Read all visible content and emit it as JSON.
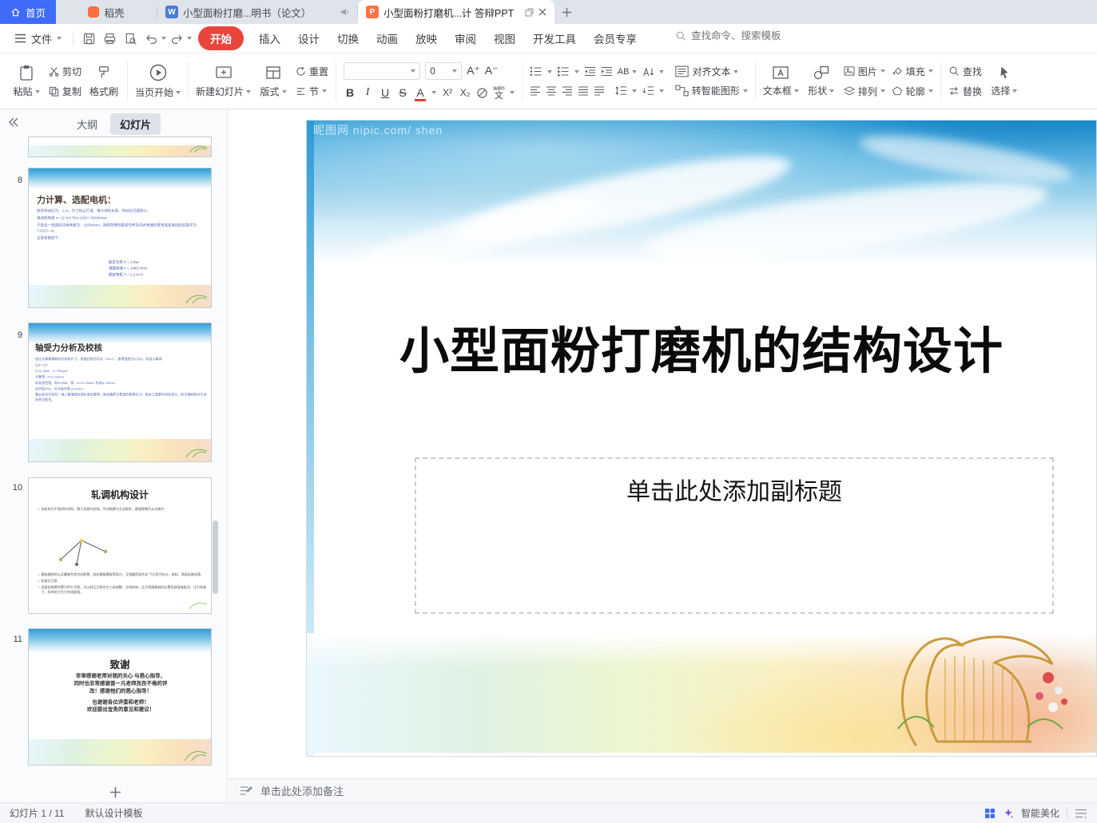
{
  "colors": {
    "home_tab_blue": "#3f6bfa",
    "start_pill_red": "#e8443a",
    "ppt_icon_orange": "#ff7243",
    "writer_icon_blue": "#4b7bd6",
    "sky_blue": "#2d9bd6",
    "beautify_blue": "#3f6bfa"
  },
  "icons": {
    "writer_letter": "W",
    "ppt_letter": "P"
  },
  "tabbar": {
    "home": "首页",
    "docer": "稻壳",
    "doc_tab": "小型面粉打磨...明书（论文）",
    "ppt_tab": "小型面粉打磨机...计 答辩PPT"
  },
  "menubar": {
    "file": "文件",
    "items": [
      "开始",
      "插入",
      "设计",
      "切换",
      "动画",
      "放映",
      "审阅",
      "视图",
      "开发工具",
      "会员专享"
    ],
    "search_placeholder": "查找命令、搜索模板"
  },
  "ribbon": {
    "paste": "粘贴",
    "cut": "剪切",
    "copy": "复制",
    "format_painter": "格式刷",
    "start_page": "当页开始",
    "new_slide": "新建幻灯片",
    "layout": "版式",
    "reset": "重置",
    "section": "节",
    "font_size_value": "0",
    "grow": "A⁺",
    "shrink": "A⁻",
    "bold": "B",
    "italic": "I",
    "underline": "U",
    "strike": "S",
    "font_color": "A",
    "sup": "X²",
    "sub": "X₂",
    "pinyin_top": "wén",
    "pinyin_bottom": "文",
    "ab": "AB",
    "align_text": "对齐文本",
    "to_smartart": "转智能图形",
    "textbox": "文本框",
    "shape": "形状",
    "picture": "图片",
    "fill": "填充",
    "arrange": "排列",
    "outline": "轮廓",
    "find": "查找",
    "replace": "替换",
    "select": "选择"
  },
  "sidebar": {
    "tab_outline": "大纲",
    "tab_slides": "幻灯片",
    "slides": [
      {
        "num": "8",
        "title": "力计算、选配电机：",
        "paras": [
          "皮带传动比为：2~4，为了防止打滑，增大带轮包角，传动比尽量取小。",
          "电动机转速 n= (2~4)×750=1500～3000r/min",
          "于是这一范围的同步转速为：1500r/min，按照所需的额定功率及同步转速的要求选定电动机的型号为Y132S—4。",
          "主要参数如下："
        ],
        "params": [
          "额定功率 P = 4 kW",
          "满载转速 n = 1440 r/min",
          "额定转矩 T = 2.2 N·m"
        ]
      },
      {
        "num": "9",
        "title": "轴受力分析及校核",
        "lines": [
          "经过计算最薄弱处的结构尺寸，根据扭转剪切式（15-2），查得强度为公式A、标准计算表：",
          "以A=110.",
          "P=5.23kw　n=750rpm",
          "计算得: d=21.02mm",
          "标准直径值、取d≈30B、得，d=21.49mm; 标准d=32mm.",
          "初步取25A，对为轴可得 d=42mm",
          "最后综合分析时，轴上最薄弱处按标准的套筒，联系圆筒主要受的套筒压力；联系三类要传给标筑元；取正确转矩并与齿轮密切配合。"
        ]
      },
      {
        "num": "10",
        "title": "轧调机构设计",
        "bullets": [
          "本机构为平面四杆机构，属于双摇杆机构。中间摇臂为主动摇杆，磨辊摇臂为从动摇杆",
          "磨辊磨损时以及翻辊共距空间配置、轻松磨辊磨辊等高为、互相磨距离合化 气压密力松分、紧料、两面标移松落",
          "松紧压力泵",
          "此紧松装置布置可传力平衡，可以料压力泵的大小来调整、点钱的床、压力泵随着轴向位置的改变笔板花、压力泵临介、机构的工作力作成疲强。"
        ]
      },
      {
        "num": "11",
        "title": "致谢",
        "lines": [
          "非常感谢老师对我的关心 与悉心指导，",
          "同时也非常感谢曾一凡老师孜孜不倦的评",
          "改！感谢他们的悉心指导！",
          "也谢谢各位评委和老师！",
          "欢迎提出宝贵的意见和建议！"
        ]
      }
    ]
  },
  "canvas": {
    "watermark": "昵图网 nipic.com/ shen",
    "slide_title": "小型面粉打磨机的结构设计",
    "subtitle_placeholder": "单击此处添加副标题"
  },
  "notes": {
    "placeholder": "单击此处添加备注"
  },
  "statusbar": {
    "slide_info": "幻灯片 1 / 11",
    "template": "默认设计模板",
    "beautify": "智能美化"
  }
}
